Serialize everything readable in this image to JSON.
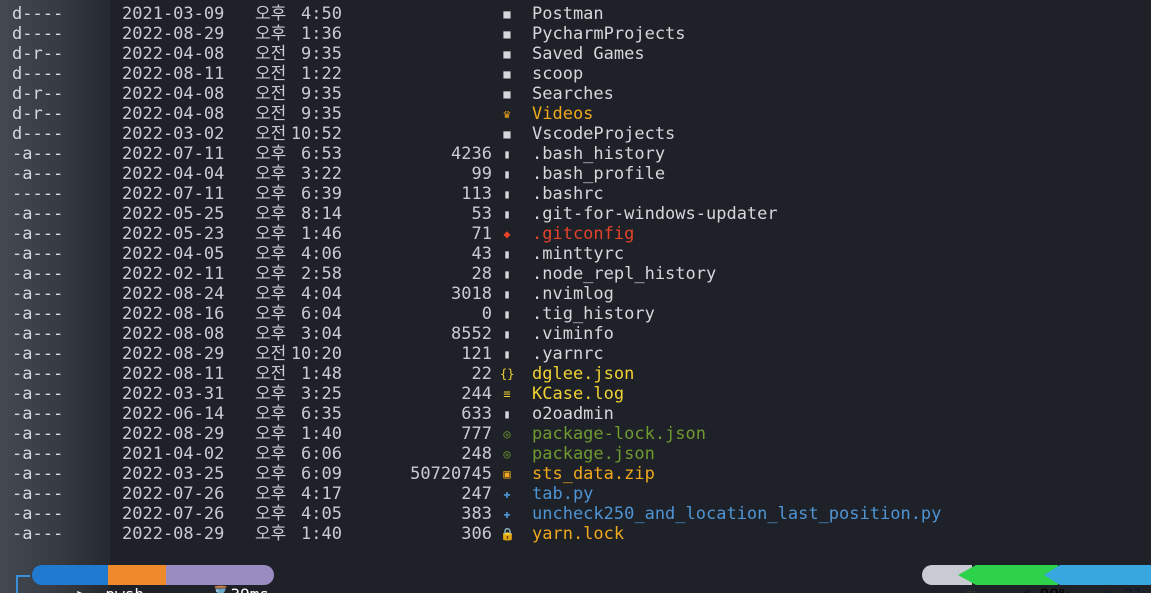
{
  "listing": [
    {
      "mode": "d----",
      "date": "2021-03-09",
      "ampm": "오후",
      "time": "4:50",
      "size": "",
      "icon": "folder-icon",
      "name": "Postman",
      "color": "dir"
    },
    {
      "mode": "d----",
      "date": "2022-08-29",
      "ampm": "오후",
      "time": "1:36",
      "size": "",
      "icon": "folder-icon",
      "name": "PycharmProjects",
      "color": "dir"
    },
    {
      "mode": "d-r--",
      "date": "2022-04-08",
      "ampm": "오전",
      "time": "9:35",
      "size": "",
      "icon": "folder-icon",
      "name": "Saved Games",
      "color": "dir"
    },
    {
      "mode": "d----",
      "date": "2022-08-11",
      "ampm": "오전",
      "time": "1:22",
      "size": "",
      "icon": "folder-icon",
      "name": "scoop",
      "color": "dir"
    },
    {
      "mode": "d-r--",
      "date": "2022-04-08",
      "ampm": "오전",
      "time": "9:35",
      "size": "",
      "icon": "folder-icon",
      "name": "Searches",
      "color": "dir"
    },
    {
      "mode": "d-r--",
      "date": "2022-04-08",
      "ampm": "오전",
      "time": "9:35",
      "size": "",
      "icon": "video-folder-icon",
      "name": "Videos",
      "color": "orange"
    },
    {
      "mode": "d----",
      "date": "2022-03-02",
      "ampm": "오전",
      "time": "10:52",
      "size": "",
      "icon": "folder-icon",
      "name": "VscodeProjects",
      "color": "dir"
    },
    {
      "mode": "-a---",
      "date": "2022-07-11",
      "ampm": "오후",
      "time": "6:53",
      "size": "4236",
      "icon": "file-icon",
      "name": ".bash_history",
      "color": "file"
    },
    {
      "mode": "-a---",
      "date": "2022-04-04",
      "ampm": "오후",
      "time": "3:22",
      "size": "99",
      "icon": "file-icon",
      "name": ".bash_profile",
      "color": "file"
    },
    {
      "mode": "-----",
      "date": "2022-07-11",
      "ampm": "오후",
      "time": "6:39",
      "size": "113",
      "icon": "file-icon",
      "name": ".bashrc",
      "color": "file"
    },
    {
      "mode": "-a---",
      "date": "2022-05-25",
      "ampm": "오후",
      "time": "8:14",
      "size": "53",
      "icon": "file-icon",
      "name": ".git-for-windows-updater",
      "color": "file"
    },
    {
      "mode": "-a---",
      "date": "2022-05-23",
      "ampm": "오후",
      "time": "1:46",
      "size": "71",
      "icon": "git-icon",
      "name": ".gitconfig",
      "color": "red"
    },
    {
      "mode": "-a---",
      "date": "2022-04-05",
      "ampm": "오후",
      "time": "4:06",
      "size": "43",
      "icon": "file-icon",
      "name": ".minttyrc",
      "color": "file"
    },
    {
      "mode": "-a---",
      "date": "2022-02-11",
      "ampm": "오후",
      "time": "2:58",
      "size": "28",
      "icon": "file-icon",
      "name": ".node_repl_history",
      "color": "file"
    },
    {
      "mode": "-a---",
      "date": "2022-08-24",
      "ampm": "오후",
      "time": "4:04",
      "size": "3018",
      "icon": "file-icon",
      "name": ".nvimlog",
      "color": "file"
    },
    {
      "mode": "-a---",
      "date": "2022-08-16",
      "ampm": "오후",
      "time": "6:04",
      "size": "0",
      "icon": "file-icon",
      "name": ".tig_history",
      "color": "file"
    },
    {
      "mode": "-a---",
      "date": "2022-08-08",
      "ampm": "오후",
      "time": "3:04",
      "size": "8552",
      "icon": "file-icon",
      "name": ".viminfo",
      "color": "file"
    },
    {
      "mode": "-a---",
      "date": "2022-08-29",
      "ampm": "오전",
      "time": "10:20",
      "size": "121",
      "icon": "file-icon",
      "name": ".yarnrc",
      "color": "file"
    },
    {
      "mode": "-a---",
      "date": "2022-08-11",
      "ampm": "오전",
      "time": "1:48",
      "size": "22",
      "icon": "json-icon",
      "name": "dglee.json",
      "color": "yellow"
    },
    {
      "mode": "-a---",
      "date": "2022-03-31",
      "ampm": "오후",
      "time": "3:25",
      "size": "244",
      "icon": "log-icon",
      "name": "KCase.log",
      "color": "yellow"
    },
    {
      "mode": "-a---",
      "date": "2022-06-14",
      "ampm": "오후",
      "time": "6:35",
      "size": "633",
      "icon": "file-icon",
      "name": "o2oadmin",
      "color": "file"
    },
    {
      "mode": "-a---",
      "date": "2022-08-29",
      "ampm": "오후",
      "time": "1:40",
      "size": "777",
      "icon": "node-icon",
      "name": "package-lock.json",
      "color": "green"
    },
    {
      "mode": "-a---",
      "date": "2021-04-02",
      "ampm": "오후",
      "time": "6:06",
      "size": "248",
      "icon": "node-icon",
      "name": "package.json",
      "color": "green"
    },
    {
      "mode": "-a---",
      "date": "2022-03-25",
      "ampm": "오후",
      "time": "6:09",
      "size": "50720745",
      "icon": "zip-icon",
      "name": "sts_data.zip",
      "color": "orange"
    },
    {
      "mode": "-a---",
      "date": "2022-07-26",
      "ampm": "오후",
      "time": "4:17",
      "size": "247",
      "icon": "python-icon",
      "name": "tab.py",
      "color": "blue"
    },
    {
      "mode": "-a---",
      "date": "2022-07-26",
      "ampm": "오후",
      "time": "4:05",
      "size": "383",
      "icon": "python-icon",
      "name": "uncheck250_and_location_last_position.py",
      "color": "blue"
    },
    {
      "mode": "-a---",
      "date": "2022-08-29",
      "ampm": "오후",
      "time": "1:40",
      "size": "306",
      "icon": "lock-icon",
      "name": "yarn.lock",
      "color": "orange"
    }
  ],
  "icon_glyphs": {
    "folder-icon": "■",
    "video-folder-icon": "♛",
    "file-icon": "▮",
    "git-icon": "◆",
    "json-icon": "{}",
    "log-icon": "≡",
    "node-icon": "◎",
    "zip-icon": "▣",
    "python-icon": "✚",
    "lock-icon": "🔒"
  },
  "icon_colors": {
    "folder-icon": "#d4d7dc",
    "video-folder-icon": "#f0a81c",
    "file-icon": "#d4d7dc",
    "git-icon": "#e3432a",
    "json-icon": "#f0d234",
    "log-icon": "#f0d234",
    "node-icon": "#6f9a2f",
    "zip-icon": "#f0a81c",
    "python-icon": "#4f94d4",
    "lock-icon": "#f0a81c"
  },
  "prompt": {
    "shell_label": ">_ pwsh",
    "path_label": "■→⌂",
    "exec_time": "⌛39ms",
    "os_icon": "⊞",
    "battery": "⚡ 99%",
    "clock": "◷ 31,20"
  },
  "colors": {
    "background": "#1e2127",
    "shell_segment": "#1f7ad0",
    "path_segment": "#ef8a2c",
    "time_segment": "#9a8bc0",
    "battery_segment": "#2ed24a",
    "clock_segment": "#38a7e0"
  }
}
